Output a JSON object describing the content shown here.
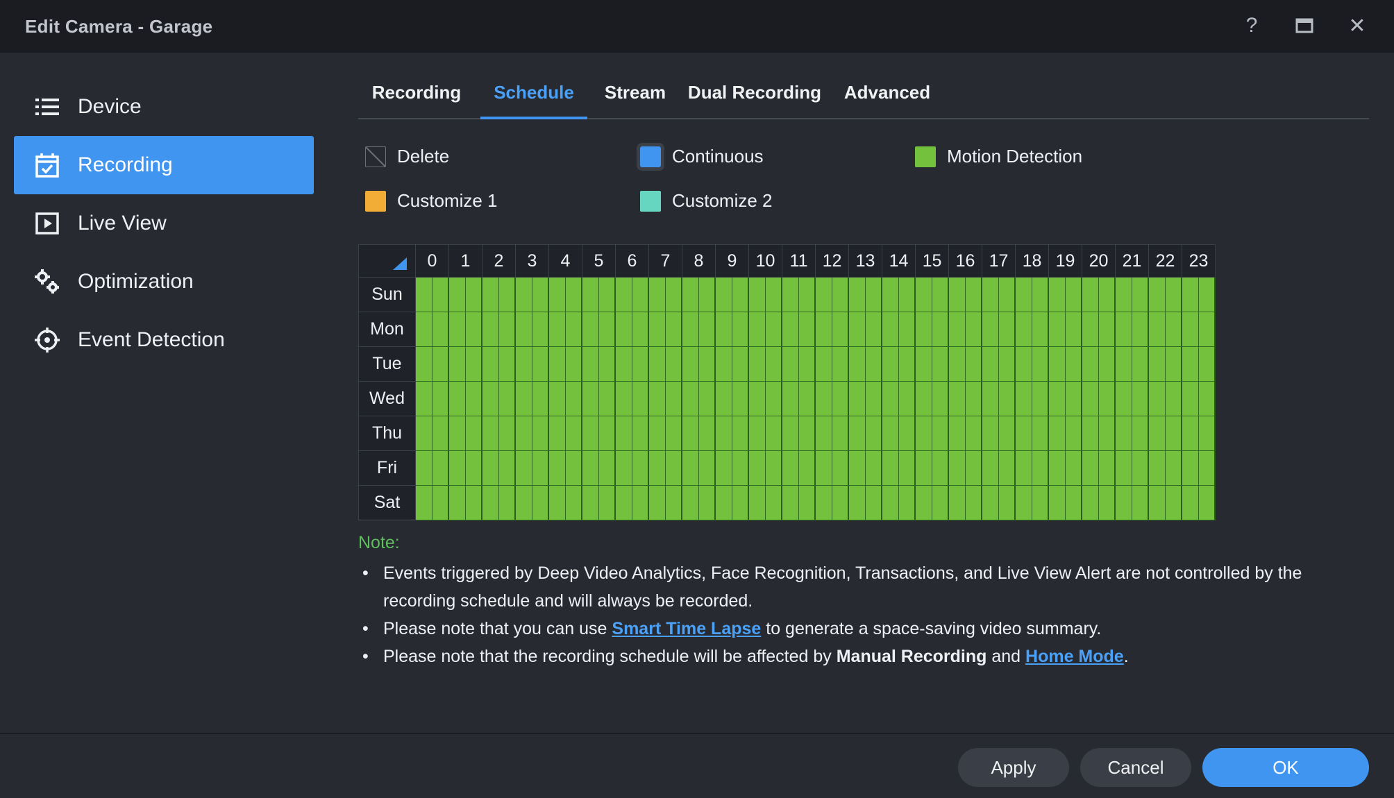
{
  "window": {
    "title": "Edit Camera - Garage",
    "controls": [
      {
        "name": "help-icon",
        "glyph": "?"
      },
      {
        "name": "maximize-icon",
        "glyph": "▭"
      },
      {
        "name": "close-icon",
        "glyph": "✕"
      }
    ]
  },
  "sidebar": {
    "items": [
      {
        "label": "Device",
        "icon": "list-icon",
        "active": false
      },
      {
        "label": "Recording",
        "icon": "calendar-check-icon",
        "active": true
      },
      {
        "label": "Live View",
        "icon": "play-square-icon",
        "active": false
      },
      {
        "label": "Optimization",
        "icon": "gears-icon",
        "active": false
      },
      {
        "label": "Event Detection",
        "icon": "crosshair-icon",
        "active": false
      }
    ]
  },
  "tabs": [
    {
      "label": "Recording",
      "active": false
    },
    {
      "label": "Schedule",
      "active": true
    },
    {
      "label": "Stream",
      "active": false
    },
    {
      "label": "Dual Recording",
      "active": false
    },
    {
      "label": "Advanced",
      "active": false
    }
  ],
  "legend": {
    "delete": "Delete",
    "continuous": "Continuous",
    "motion": "Motion Detection",
    "custom1": "Customize 1",
    "custom2": "Customize 2"
  },
  "colors": {
    "accent": "#3f95ef",
    "motion": "#73c13d",
    "continuous": "#3f95ef",
    "custom1": "#f1ad36",
    "custom2": "#66d6c0",
    "note": "#5fbf5d"
  },
  "schedule": {
    "hours": [
      "0",
      "1",
      "2",
      "3",
      "4",
      "5",
      "6",
      "7",
      "8",
      "9",
      "10",
      "11",
      "12",
      "13",
      "14",
      "15",
      "16",
      "17",
      "18",
      "19",
      "20",
      "21",
      "22",
      "23"
    ],
    "days": [
      "Sun",
      "Mon",
      "Tue",
      "Wed",
      "Thu",
      "Fri",
      "Sat"
    ],
    "fill_mode": "Motion Detection"
  },
  "note": {
    "title": "Note:",
    "item1": "Events triggered by Deep Video Analytics, Face Recognition, Transactions, and Live View Alert are not controlled by the recording schedule and will always be recorded.",
    "item2_pre": "Please note that you can use ",
    "item2_link": "Smart Time Lapse",
    "item2_post": " to generate a space-saving video summary.",
    "item3_pre": "Please note that the recording schedule will be affected by ",
    "item3_bold": "Manual Recording",
    "item3_mid": " and ",
    "item3_link": "Home Mode",
    "item3_post": "."
  },
  "footer": {
    "apply": "Apply",
    "cancel": "Cancel",
    "ok": "OK"
  }
}
